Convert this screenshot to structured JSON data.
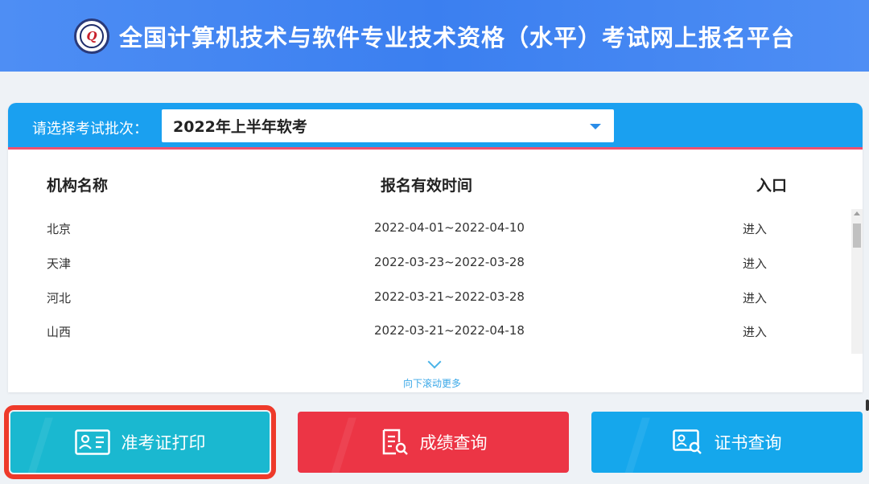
{
  "header": {
    "logo_letter": "Q",
    "title": "全国计算机技术与软件专业技术资格（水平）考试网上报名平台"
  },
  "batch": {
    "label": "请选择考试批次：",
    "selected": "2022年上半年软考"
  },
  "table": {
    "columns": [
      "机构名称",
      "报名有效时间",
      "入口"
    ],
    "rows": [
      {
        "name": "北京",
        "period": "2022-04-01~2022-04-10",
        "entry": "进入"
      },
      {
        "name": "天津",
        "period": "2022-03-23~2022-03-28",
        "entry": "进入"
      },
      {
        "name": "河北",
        "period": "2022-03-21~2022-03-28",
        "entry": "进入"
      },
      {
        "name": "山西",
        "period": "2022-03-21~2022-04-18",
        "entry": "进入"
      }
    ],
    "more_label": "向下滚动更多"
  },
  "actions": {
    "admit_label": "准考证打印",
    "score_label": "成绩查询",
    "cert_label": "证书查询"
  },
  "colors": {
    "header": "#3b7ff0",
    "batch_bar": "#1aa0f0",
    "admit": "#1ab8d0",
    "score": "#ec3545",
    "cert": "#15a7ec",
    "highlight": "#ee3a2a"
  },
  "icons": [
    "logo-icon",
    "dropdown-caret-icon",
    "chevron-down-icon",
    "id-card-icon",
    "report-search-icon",
    "certificate-search-icon"
  ]
}
